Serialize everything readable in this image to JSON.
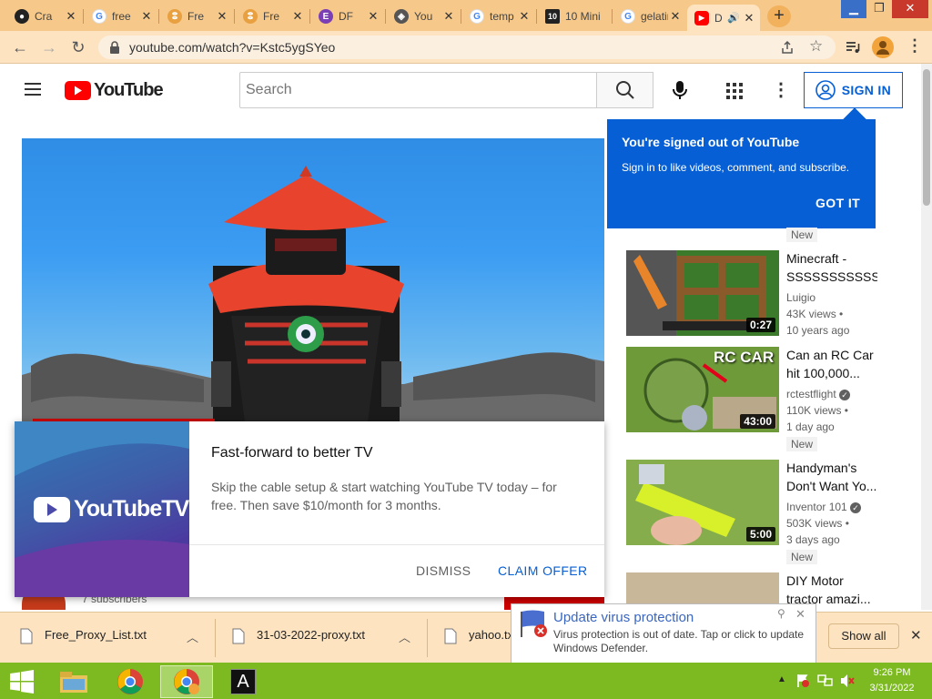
{
  "browser": {
    "tabs": [
      {
        "title": "Cra",
        "icon": "github-icon"
      },
      {
        "title": "free",
        "icon": "google-icon"
      },
      {
        "title": "Fre",
        "icon": "proxy-icon"
      },
      {
        "title": "Fre",
        "icon": "proxy-icon"
      },
      {
        "title": "DF",
        "icon": "dfr-icon"
      },
      {
        "title": "You",
        "icon": "shield-icon"
      },
      {
        "title": "temp m",
        "icon": "google-icon"
      },
      {
        "title": "10 Mini",
        "icon": "ten-icon"
      },
      {
        "title": "gelatin",
        "icon": "google-icon"
      },
      {
        "title": "D",
        "icon": "youtube-icon",
        "active": true
      }
    ],
    "url": "youtube.com/watch?v=Kstc5ygSYeo"
  },
  "youtube": {
    "logo_text": "YouTube",
    "search_placeholder": "Search",
    "sign_in_label": "SIGN IN"
  },
  "popup": {
    "title": "You're signed out of YouTube",
    "body": "Sign in to like videos, comment, and subscribe.",
    "button": "GOT IT"
  },
  "recommendations": [
    {
      "badge": "New",
      "title": [
        "Minecraft -",
        "SSSSSSSSSSSSS"
      ],
      "channel": "Luigio",
      "verified": false,
      "views": "43K views •",
      "age": "10 years ago",
      "duration": "0:27"
    },
    {
      "badge": "",
      "title": [
        "Can an RC Car",
        "hit 100,000..."
      ],
      "channel": "rctestflight",
      "verified": true,
      "views": "110K views •",
      "age": "1 day ago",
      "duration": "43:00",
      "thumb_text": "RC CAR"
    },
    {
      "badge": "New",
      "title": [
        "Handyman's",
        "Don't Want Yo..."
      ],
      "channel": "Inventor 101",
      "verified": true,
      "views": "503K views •",
      "age": "3 days ago",
      "duration": "5:00"
    },
    {
      "badge": "New",
      "title": [
        "DIY Motor",
        "tractor amazi..."
      ],
      "channel": "",
      "verified": false,
      "views": "",
      "age": "",
      "duration": ""
    }
  ],
  "ytv_offer": {
    "logo_text": "YouTubeTV",
    "heading": "Fast-forward to better TV",
    "body": "Skip the cable setup & start watching YouTube TV today – for free. Then save $10/month for 3 months.",
    "dismiss": "DISMISS",
    "claim": "CLAIM OFFER"
  },
  "below_video": {
    "subscribers": "7 subscribers"
  },
  "downloads": {
    "items": [
      "Free_Proxy_List.txt",
      "31-03-2022-proxy.txt",
      "yahoo.txt"
    ],
    "show_all": "Show all"
  },
  "notification": {
    "title": "Update virus protection",
    "body": "Virus protection is out of date. Tap or click to update Windows Defender."
  },
  "taskbar": {
    "time": "9:26 PM",
    "date": "3/31/2022"
  },
  "colors": {
    "youtube_red": "#ff0000",
    "youtube_blue": "#065fd4",
    "tab_strip": "#f6c88a",
    "taskbar": "#7dba22"
  }
}
